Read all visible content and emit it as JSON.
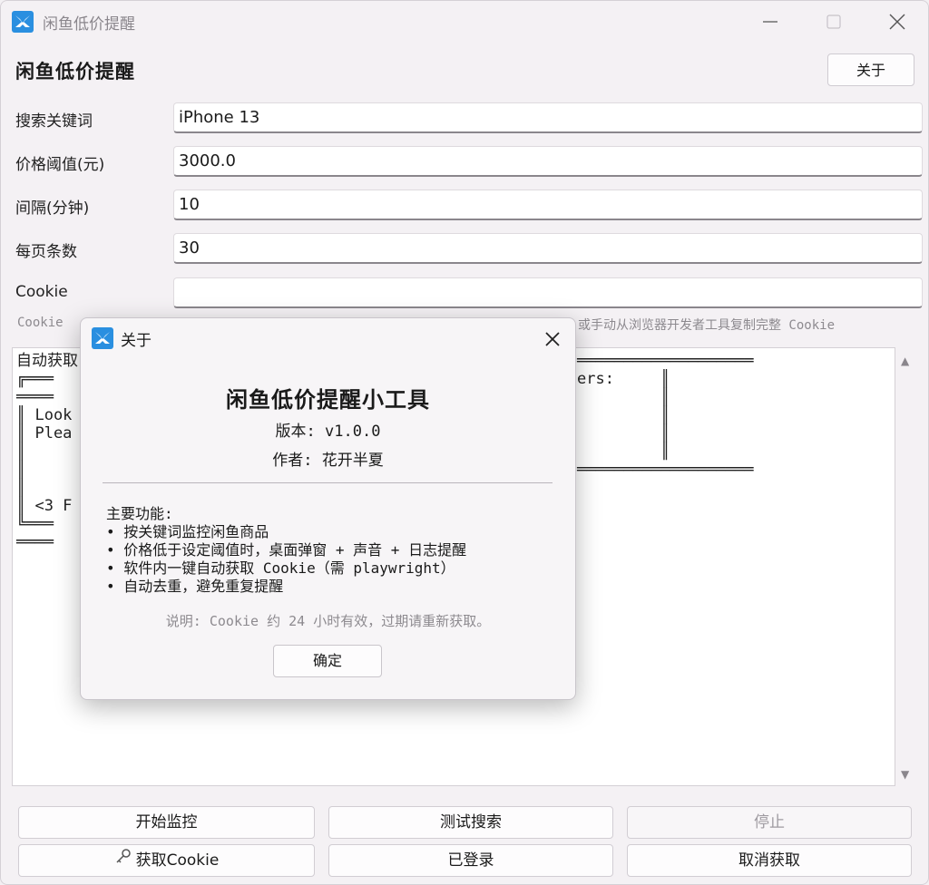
{
  "window": {
    "title": "闲鱼低价提醒",
    "icon": "swallow-app-icon",
    "controls": [
      "minimize-icon",
      "maximize-icon",
      "close-icon"
    ]
  },
  "header": {
    "title": "闲鱼低价提醒",
    "about_label": "关于"
  },
  "form": {
    "keyword": {
      "label": "搜索关键词",
      "value": "iPhone 13"
    },
    "threshold": {
      "label": "价格阈值(元)",
      "value": "3000.0"
    },
    "interval": {
      "label": "间隔(分钟)",
      "value": "10"
    },
    "per_page": {
      "label": "每页条数",
      "value": "30"
    },
    "cookie": {
      "label": "Cookie",
      "value": ""
    }
  },
  "cookie_hint": {
    "left": "Cookie",
    "right": "或手动从浏览器开发者工具复制完整 Cookie"
  },
  "log": {
    "lines": [
      "自动获取",
      "╔═══",
      "════",
      "║ Look",
      "║ Plea",
      "║",
      "║",
      "║",
      "║ <3 F",
      "╚═══",
      "════"
    ],
    "right_lines": [
      "",
      "═══════════════════",
      "",
      "",
      "ers:     ║",
      "         ║",
      "         ║",
      "         ║",
      "         ║",
      "═══════════════════",
      ""
    ]
  },
  "buttons": {
    "start": "开始监控",
    "test_search": "测试搜索",
    "stop": "停止",
    "get_cookie": "获取Cookie",
    "logged_in": "已登录",
    "cancel_fetch": "取消获取"
  },
  "modal": {
    "title": "关于",
    "heading": "闲鱼低价提醒小工具",
    "version": "版本: v1.0.0",
    "author": "作者: 花开半夏",
    "features_title": "主要功能:",
    "features": [
      "• 按关键词监控闲鱼商品",
      "• 价格低于设定阈值时，桌面弹窗 + 声音 + 日志提醒",
      "• 软件内一键自动获取 Cookie（需 playwright）",
      "• 自动去重，避免重复提醒"
    ],
    "note": "说明: Cookie 约 24 小时有效，过期请重新获取。",
    "ok_label": "确定"
  },
  "colors": {
    "window_bg": "#f4f1f4",
    "app_icon": "#2a8fe0",
    "input_underline": "#8a868c",
    "hint_text": "#8d8a8f"
  }
}
